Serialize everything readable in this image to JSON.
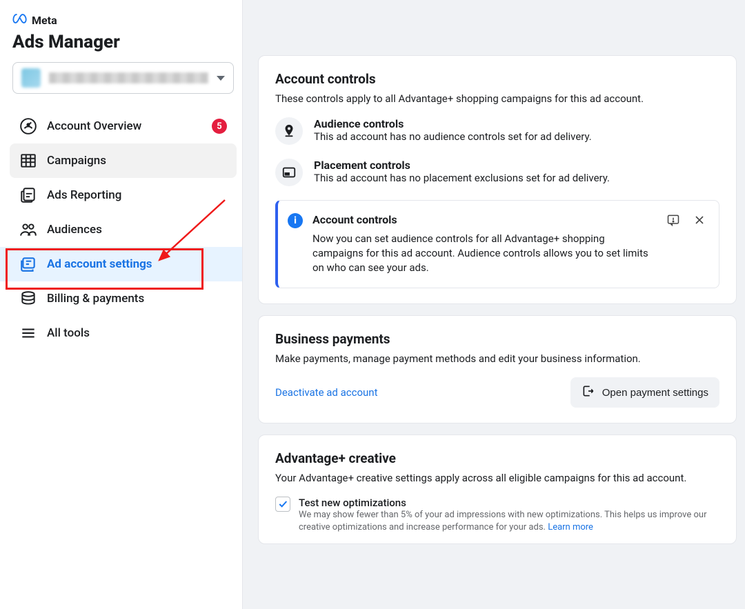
{
  "brand": {
    "name": "Meta",
    "app_title": "Ads Manager"
  },
  "sidebar": {
    "items": [
      {
        "label": "Account Overview",
        "badge": "5"
      },
      {
        "label": "Campaigns"
      },
      {
        "label": "Ads Reporting"
      },
      {
        "label": "Audiences"
      },
      {
        "label": "Ad account settings"
      },
      {
        "label": "Billing & payments"
      },
      {
        "label": "All tools"
      }
    ]
  },
  "account_controls": {
    "title": "Account controls",
    "subtitle": "These controls apply to all Advantage+ shopping campaigns for this ad account.",
    "audience": {
      "title": "Audience controls",
      "desc": "This ad account has no audience controls set for ad delivery."
    },
    "placement": {
      "title": "Placement controls",
      "desc": "This ad account has no placement exclusions set for ad delivery."
    },
    "info": {
      "title": "Account controls",
      "desc": "Now you can set audience controls for all Advantage+ shopping campaigns for this ad account. Audience controls allows you to set limits on who can see your ads."
    }
  },
  "payments": {
    "title": "Business payments",
    "subtitle": "Make payments, manage payment methods and edit your business information.",
    "deactivate": "Deactivate ad account",
    "open_settings": "Open payment settings"
  },
  "creative": {
    "title": "Advantage+ creative",
    "subtitle": "Your Advantage+ creative settings apply across all eligible campaigns for this ad account.",
    "checkbox_label": "Test new optimizations",
    "checkbox_desc": "We may show fewer than 5% of your ad impressions with new optimizations. This helps us improve our creative optimizations and increase performance for your ads. ",
    "learn_more": "Learn more"
  }
}
